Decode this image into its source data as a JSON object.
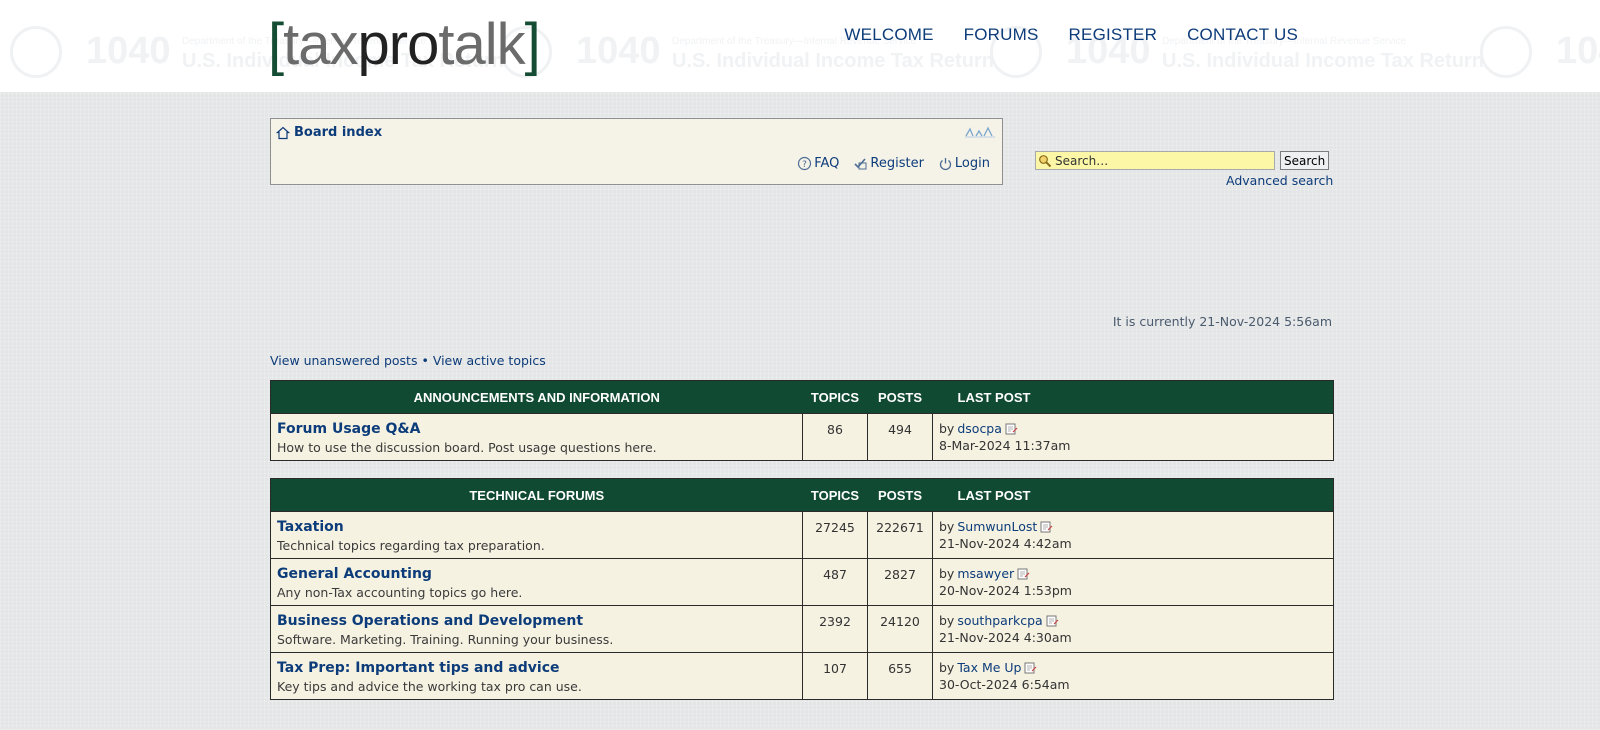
{
  "header": {
    "logo": {
      "bracket_open": "[",
      "tax": "tax",
      "pro": "pro",
      "talk": "talk",
      "bracket_close": "]"
    },
    "nav": [
      "WELCOME",
      "FORUMS",
      "REGISTER",
      "CONTACT US"
    ],
    "watermark": {
      "number": "1040",
      "caption": "U.S. Individual Income Tax Return",
      "small_caption": "Department of the Treasury—Internal Revenue Service"
    }
  },
  "breadcrumb": {
    "label": "Board index",
    "icon": "home-icon"
  },
  "navlinks": {
    "faq": "FAQ",
    "register": "Register",
    "login": "Login"
  },
  "search": {
    "placeholder": "Search…",
    "button": "Search",
    "advanced": "Advanced search"
  },
  "current_time": "It is currently 21-Nov-2024 5:56am",
  "quick_links": {
    "unanswered": "View unanswered posts",
    "separator": "•",
    "active": "View active topics"
  },
  "sections": [
    {
      "header": "ANNOUNCEMENTS AND INFORMATION",
      "col_topics": "TOPICS",
      "col_posts": "POSTS",
      "col_lastpost": "LAST POST",
      "forums": [
        {
          "title": "Forum Usage Q&A",
          "desc": "How to use the discussion board. Post usage questions here.",
          "topics": "86",
          "posts": "494",
          "by": "by",
          "user": "dsocpa",
          "date": "8-Mar-2024 11:37am"
        }
      ]
    },
    {
      "header": "TECHNICAL FORUMS",
      "col_topics": "TOPICS",
      "col_posts": "POSTS",
      "col_lastpost": "LAST POST",
      "forums": [
        {
          "title": "Taxation",
          "desc": "Technical topics regarding tax preparation.",
          "topics": "27245",
          "posts": "222671",
          "by": "by",
          "user": "SumwunLost",
          "date": "21-Nov-2024 4:42am"
        },
        {
          "title": "General Accounting",
          "desc": "Any non-Tax accounting topics go here.",
          "topics": "487",
          "posts": "2827",
          "by": "by",
          "user": "msawyer",
          "date": "20-Nov-2024 1:53pm"
        },
        {
          "title": "Business Operations and Development",
          "desc": "Software. Marketing. Training. Running your business.",
          "topics": "2392",
          "posts": "24120",
          "by": "by",
          "user": "southparkcpa",
          "date": "21-Nov-2024 4:30am"
        },
        {
          "title": "Tax Prep: Important tips and advice",
          "desc": "Key tips and advice the working tax pro can use.",
          "topics": "107",
          "posts": "655",
          "by": "by",
          "user": "Tax Me Up",
          "date": "30-Oct-2024 6:54am"
        }
      ]
    }
  ],
  "colors": {
    "forum_header_bg": "#114a33",
    "link": "#0d3c7a",
    "row_bg": "#f5f2e2",
    "search_bg": "#fbf7a6"
  }
}
